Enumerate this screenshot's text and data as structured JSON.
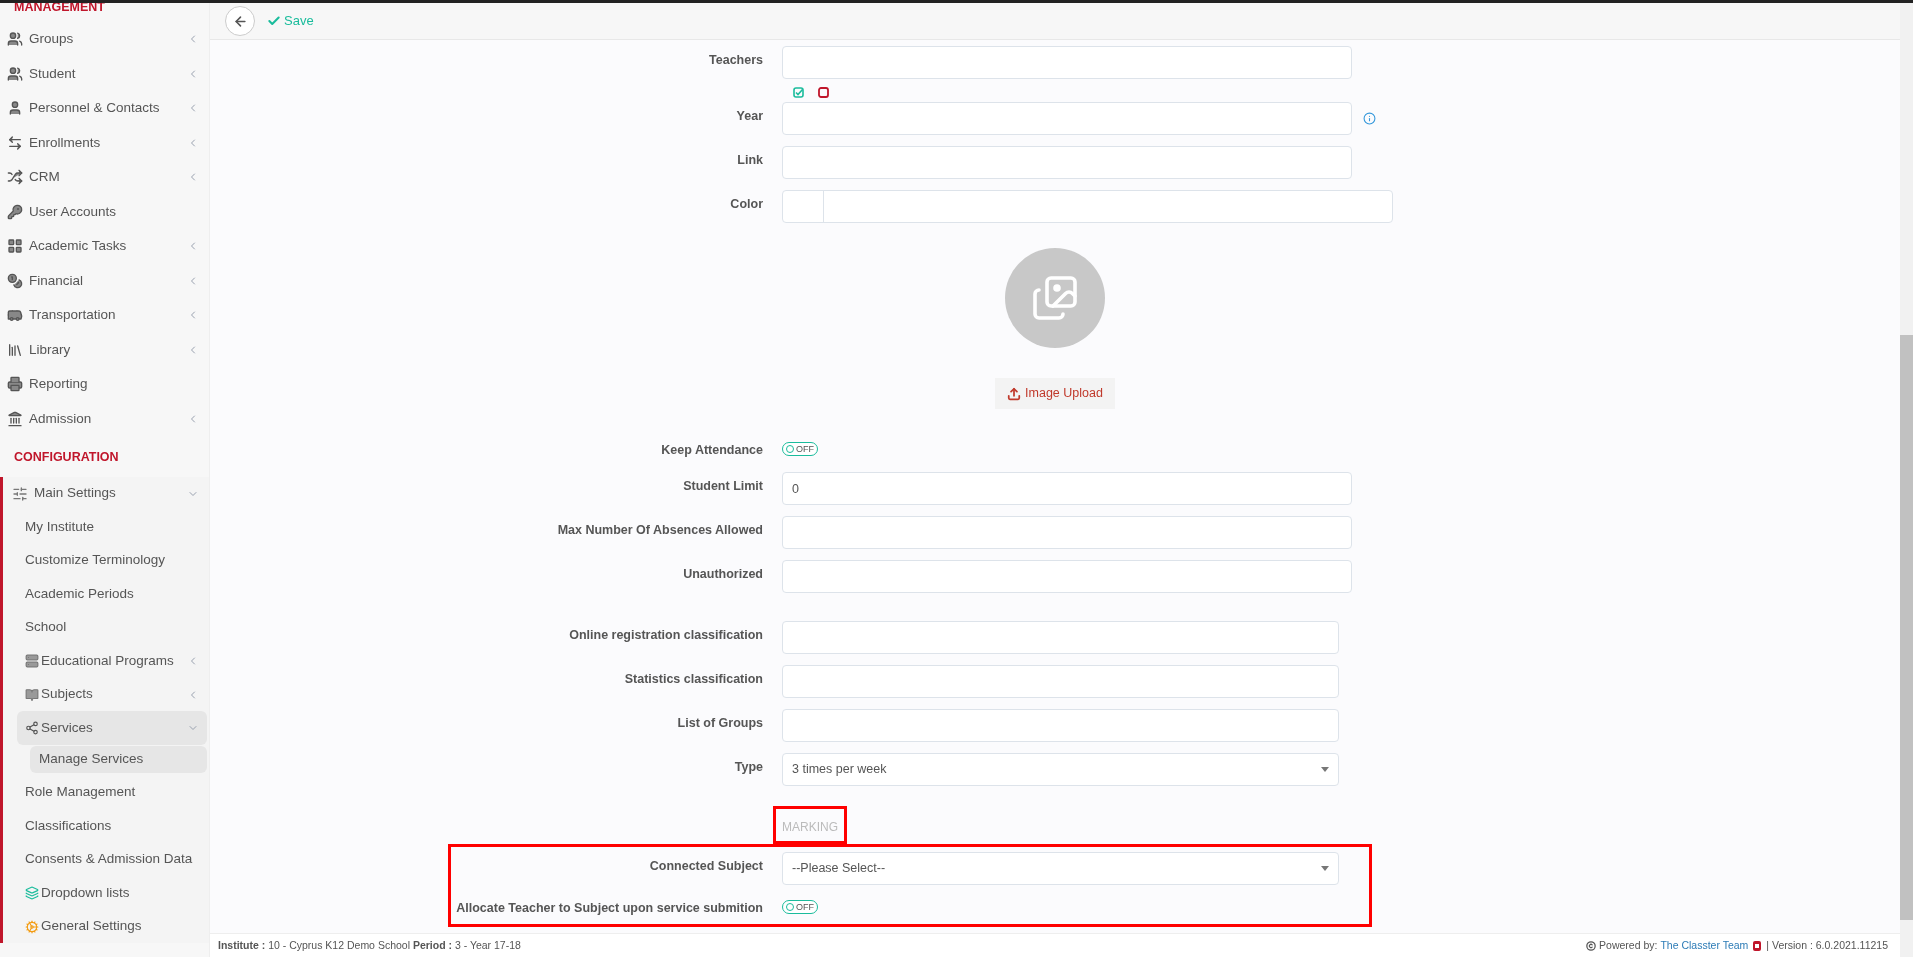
{
  "toolbar": {
    "save_label": "Save"
  },
  "sidebar": {
    "sections": [
      {
        "title": "MANAGEMENT",
        "items": [
          {
            "label": "Groups",
            "expandable": true,
            "expanded": false
          },
          {
            "label": "Student",
            "expandable": true,
            "expanded": false
          },
          {
            "label": "Personnel & Contacts",
            "expandable": true,
            "expanded": false
          },
          {
            "label": "Enrollments",
            "expandable": true,
            "expanded": false
          },
          {
            "label": "CRM",
            "expandable": true,
            "expanded": false
          },
          {
            "label": "User Accounts",
            "expandable": false
          },
          {
            "label": "Academic Tasks",
            "expandable": true,
            "expanded": false
          },
          {
            "label": "Financial",
            "expandable": true,
            "expanded": false
          },
          {
            "label": "Transportation",
            "expandable": true,
            "expanded": false
          },
          {
            "label": "Library",
            "expandable": true,
            "expanded": false
          },
          {
            "label": "Reporting",
            "expandable": false
          },
          {
            "label": "Admission",
            "expandable": true,
            "expanded": false
          }
        ]
      },
      {
        "title": "CONFIGURATION",
        "items": [
          {
            "label": "Main Settings",
            "expandable": true,
            "expanded": true,
            "children": [
              {
                "label": "My Institute",
                "expandable": false,
                "selected": false
              },
              {
                "label": "Customize Terminology",
                "expandable": false,
                "selected": false
              },
              {
                "label": "Academic Periods",
                "expandable": false,
                "selected": false
              },
              {
                "label": "School",
                "expandable": false,
                "selected": false
              },
              {
                "label": "Educational Programs",
                "expandable": true,
                "expanded": false,
                "selected": false
              },
              {
                "label": "Subjects",
                "expandable": true,
                "expanded": false,
                "selected": false
              },
              {
                "label": "Services",
                "expandable": true,
                "expanded": true,
                "selected": true,
                "children": [
                  {
                    "label": "Manage Services",
                    "expandable": false,
                    "selected": true
                  }
                ]
              },
              {
                "label": "Role Management",
                "expandable": false,
                "selected": false
              },
              {
                "label": "Classifications",
                "expandable": false,
                "selected": false
              },
              {
                "label": "Consents & Admission Data",
                "expandable": false,
                "selected": false
              },
              {
                "label": "Dropdown lists",
                "expandable": false,
                "selected": false
              },
              {
                "label": "General Settings",
                "expandable": false,
                "selected": false
              }
            ]
          }
        ]
      }
    ]
  },
  "form": {
    "blocks": [
      {
        "fields": [
          {
            "kind": "text",
            "label": "Teachers"
          },
          {
            "kind": "text",
            "label": "Year",
            "status_icons": true,
            "info_icon": true
          },
          {
            "kind": "text",
            "label": "Link"
          },
          {
            "kind": "color",
            "label": "Color"
          },
          {
            "kind": "image",
            "button_label": "Image Upload"
          },
          {
            "kind": "toggle",
            "label": "Keep Attendance",
            "on": false,
            "state_label": "OFF"
          },
          {
            "kind": "text",
            "label": "Student Limit",
            "value": "0"
          },
          {
            "kind": "text",
            "label": "Max Number Of Absences Allowed"
          },
          {
            "kind": "text",
            "label": "Unauthorized"
          }
        ]
      },
      {
        "fields": [
          {
            "kind": "text",
            "label": "Online registration classification"
          },
          {
            "kind": "text",
            "label": "Statistics classification"
          },
          {
            "kind": "text",
            "label": "List of Groups"
          },
          {
            "kind": "select",
            "label": "Type",
            "value": "3 times per week"
          }
        ]
      },
      {
        "title": "MARKING",
        "annotated": true,
        "fields": [
          {
            "kind": "select",
            "label": "Connected Subject",
            "value": "--Please Select--"
          },
          {
            "kind": "toggle",
            "label": "Allocate Teacher to Subject upon service submition",
            "on": false,
            "state_label": "OFF"
          }
        ]
      }
    ]
  },
  "footer": {
    "context": "**Institute :** 10 - Cyprus K12 Demo School **Period :** 3 - Year 17-18",
    "powered_by": "Powered by:",
    "team_link": "The Classter Team",
    "version": "| Version : 6.0.2021.11215"
  }
}
